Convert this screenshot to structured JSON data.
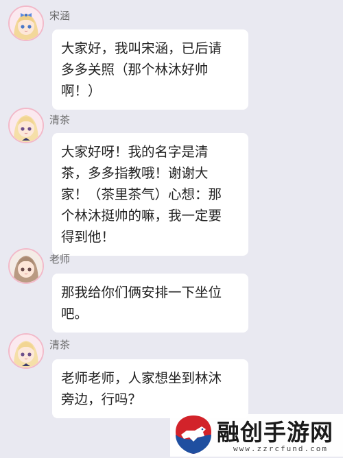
{
  "messages": [
    {
      "sender": "宋涵",
      "text": "大家好，我叫宋涵，已后请\n多多关照（那个林沐好帅\n啊！）",
      "avatar": "girl-blonde-bow-avatar"
    },
    {
      "sender": "清茶",
      "text": "大家好呀！我的名字是清\n茶，多多指教哦！谢谢大\n家！（茶里茶气）心想：那\n个林沐挺帅的嘛，我一定要\n得到他！",
      "avatar": "girl-blonde-avatar"
    },
    {
      "sender": "老师",
      "text": "那我给你们俩安排一下坐位\n吧。",
      "avatar": "girl-brown-hair-avatar"
    },
    {
      "sender": "清茶",
      "text": "老师老师，人家想坐到林沐\n旁边，行吗？",
      "avatar": "girl-blonde-avatar"
    }
  ],
  "watermark": {
    "title": "融创手游网",
    "url": "www.zzrcfund.com",
    "logo": "dog-shield-logo"
  },
  "colors": {
    "background": "#e9e9f1",
    "bubble": "#ffffff",
    "avatar_border": "#f2b9c9",
    "logo_red": "#d2232a",
    "logo_blue": "#1f4fa0"
  }
}
